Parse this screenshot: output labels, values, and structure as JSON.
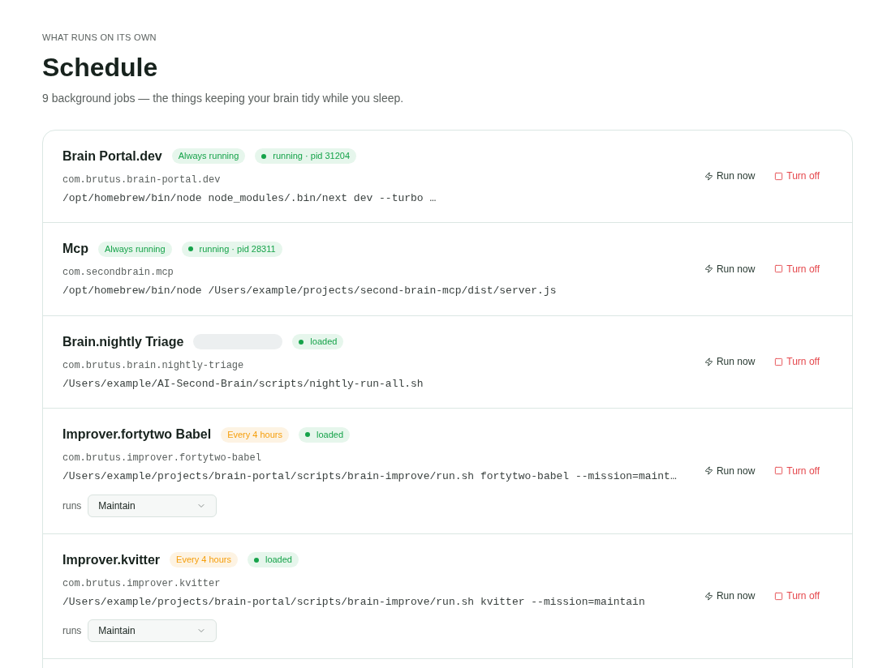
{
  "header": {
    "eyebrow": "WHAT RUNS ON ITS OWN",
    "title": "Schedule",
    "subtitle": "9 background jobs — the things keeping your brain tidy while you sleep."
  },
  "jobs": [
    {
      "name": "Brain Portal.dev",
      "schedule": {
        "kind": "always",
        "label": "Always running"
      },
      "status": "running · pid 31204",
      "label": "com.brutus.brain-portal.dev",
      "command": "/opt/homebrew/bin/node node_modules/.bin/next dev --turbo …",
      "actions": [
        "Run now",
        "Turn off"
      ]
    },
    {
      "name": "Mcp",
      "schedule": {
        "kind": "always",
        "label": "Always running"
      },
      "status": "running · pid 28311",
      "label": "com.secondbrain.mcp",
      "command": "/opt/homebrew/bin/node /Users/example/projects/second-brain-mcp/dist/server.js",
      "actions": [
        "Run now",
        "Turn off"
      ]
    },
    {
      "name": "Brain.nightly Triage",
      "schedule": {
        "kind": "blank"
      },
      "status": "loaded",
      "label": "com.brutus.brain.nightly-triage",
      "command": "/Users/example/AI-Second-Brain/scripts/nightly-run-all.sh",
      "actions": [
        "Run now",
        "Turn off"
      ]
    },
    {
      "name": "Improver.fortytwo Babel",
      "schedule": {
        "kind": "interval",
        "label": "Every 4 hours"
      },
      "status": "loaded",
      "label": "com.brutus.improver.fortytwo-babel",
      "command": "/Users/example/projects/brain-portal/scripts/brain-improve/run.sh fortytwo-babel --mission=maint…",
      "runs": {
        "label": "runs",
        "value": "Maintain"
      },
      "actions": [
        "Run now",
        "Turn off"
      ]
    },
    {
      "name": "Improver.kvitter",
      "schedule": {
        "kind": "interval",
        "label": "Every 4 hours"
      },
      "status": "loaded",
      "label": "com.brutus.improver.kvitter",
      "command": "/Users/example/projects/brain-portal/scripts/brain-improve/run.sh kvitter --mission=maintain",
      "runs": {
        "label": "runs",
        "value": "Maintain"
      },
      "actions": [
        "Run now",
        "Turn off"
      ]
    }
  ]
}
